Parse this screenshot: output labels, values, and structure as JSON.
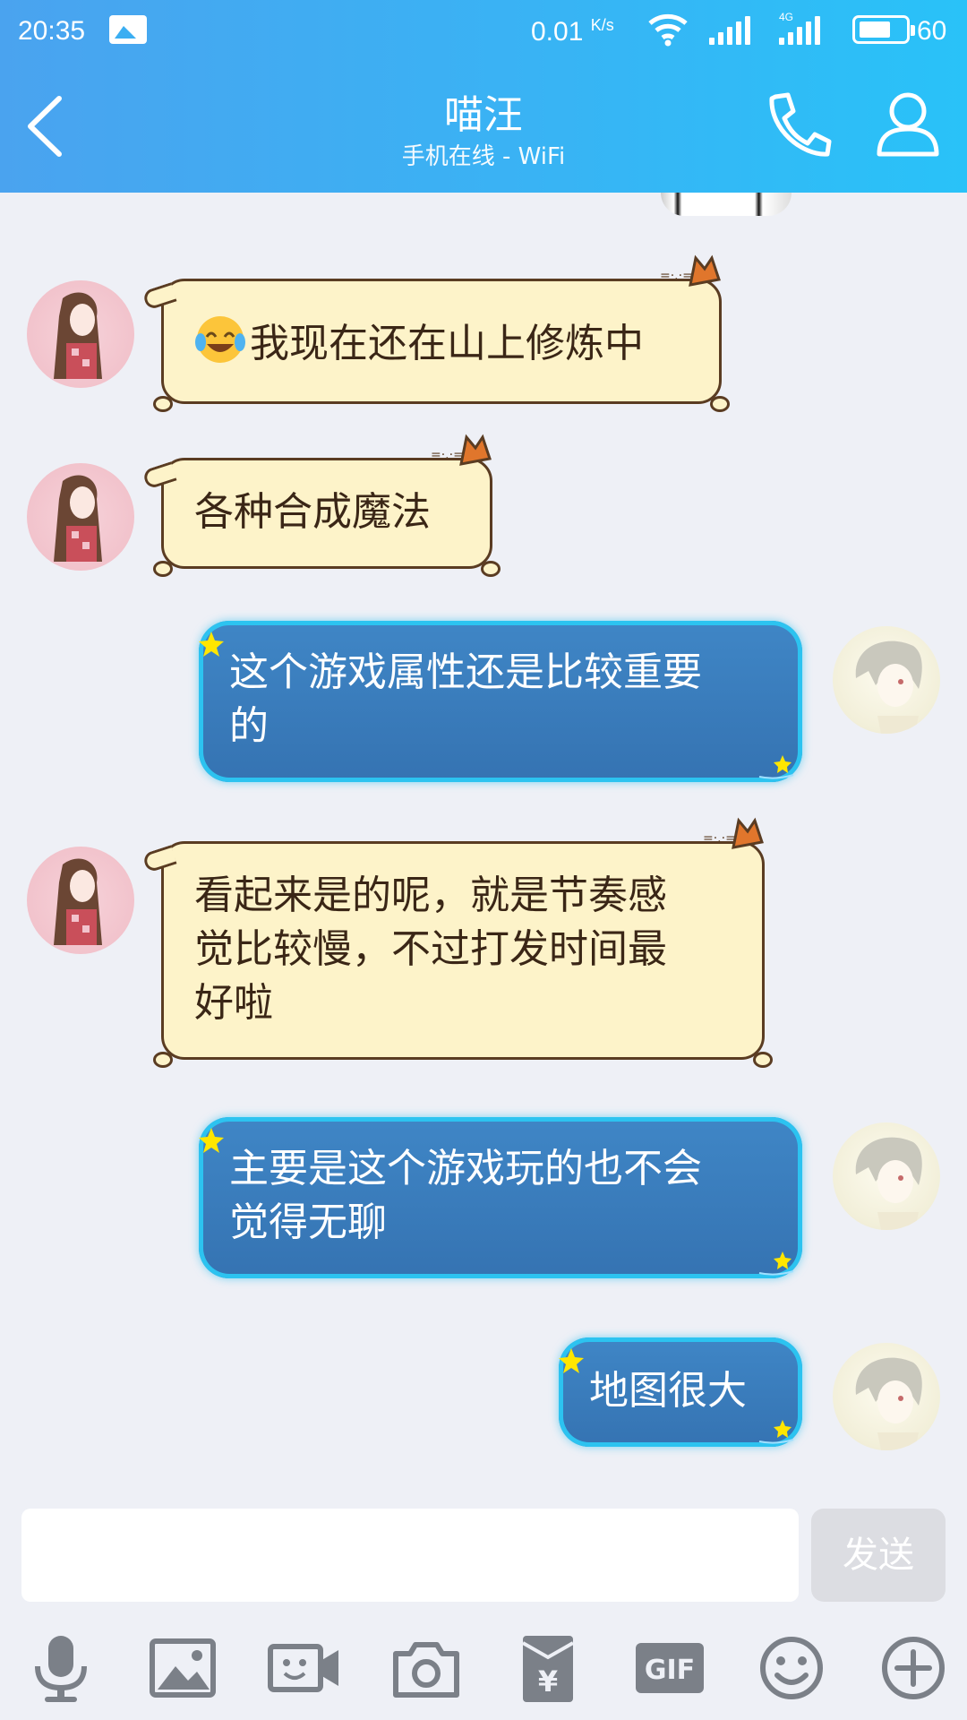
{
  "status_bar": {
    "time": "20:35",
    "speed": "0.01",
    "speed_unit": "K/s",
    "network": "4G",
    "battery": "60"
  },
  "header": {
    "title": "喵汪",
    "subtitle": "手机在线 - WiFi"
  },
  "messages": [
    {
      "side": "in",
      "text": "我现在还在山上修炼中",
      "emoji": "tears-of-joy-emoji"
    },
    {
      "side": "in",
      "text": "各种合成魔法"
    },
    {
      "side": "out",
      "lines": [
        "这个游戏属性还是比较重要",
        "的"
      ]
    },
    {
      "side": "in",
      "lines": [
        "看起来是的呢，就是节奏感",
        "觉比较慢，不过打发时间最",
        "好啦"
      ]
    },
    {
      "side": "out",
      "lines": [
        "主要是这个游戏玩的也不会",
        "觉得无聊"
      ]
    },
    {
      "side": "out",
      "text": "地图很大"
    }
  ],
  "composer": {
    "placeholder": "",
    "send_label": "发送"
  },
  "toolbar": {
    "icons": [
      "microphone-icon",
      "image-icon",
      "video-call-icon",
      "camera-icon",
      "red-packet-icon",
      "gif-icon",
      "emoji-icon",
      "plus-icon"
    ],
    "gif_label": "GIF",
    "yen_label": "¥"
  },
  "colors": {
    "header_start": "#4aa3ef",
    "header_end": "#29c2f8",
    "bubble_in": "#fdf3c9",
    "bubble_out": "#3573b2",
    "background": "#eef0f6"
  }
}
